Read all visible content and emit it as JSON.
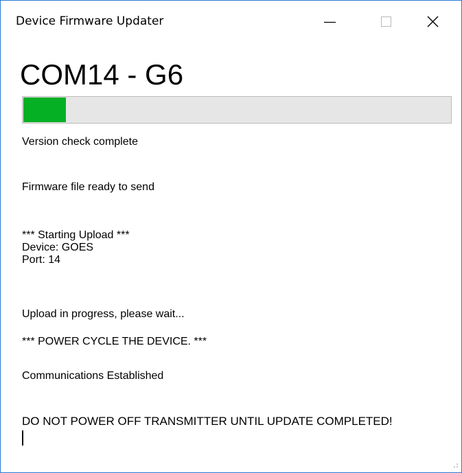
{
  "window": {
    "title": "Device Firmware Updater"
  },
  "controls": {
    "minimize_icon": "minimize-icon",
    "maximize_icon": "maximize-icon",
    "close_icon": "close-icon"
  },
  "main": {
    "heading": "COM14 - G6",
    "progress": {
      "percent": 10,
      "fill_color": "#06b025",
      "track_color": "#e6e6e6"
    },
    "log": {
      "version_check": "Version check complete",
      "firmware_ready": "Firmware file ready to send",
      "starting_upload": "*** Starting Upload ***",
      "device": "Device: GOES",
      "port": "Port: 14",
      "upload_progress": "Upload in progress, please wait...",
      "power_cycle": "*** POWER CYCLE THE DEVICE. ***",
      "comms_established": "Communications Established",
      "warning": "DO NOT POWER OFF TRANSMITTER UNTIL UPDATE COMPLETED!"
    }
  }
}
